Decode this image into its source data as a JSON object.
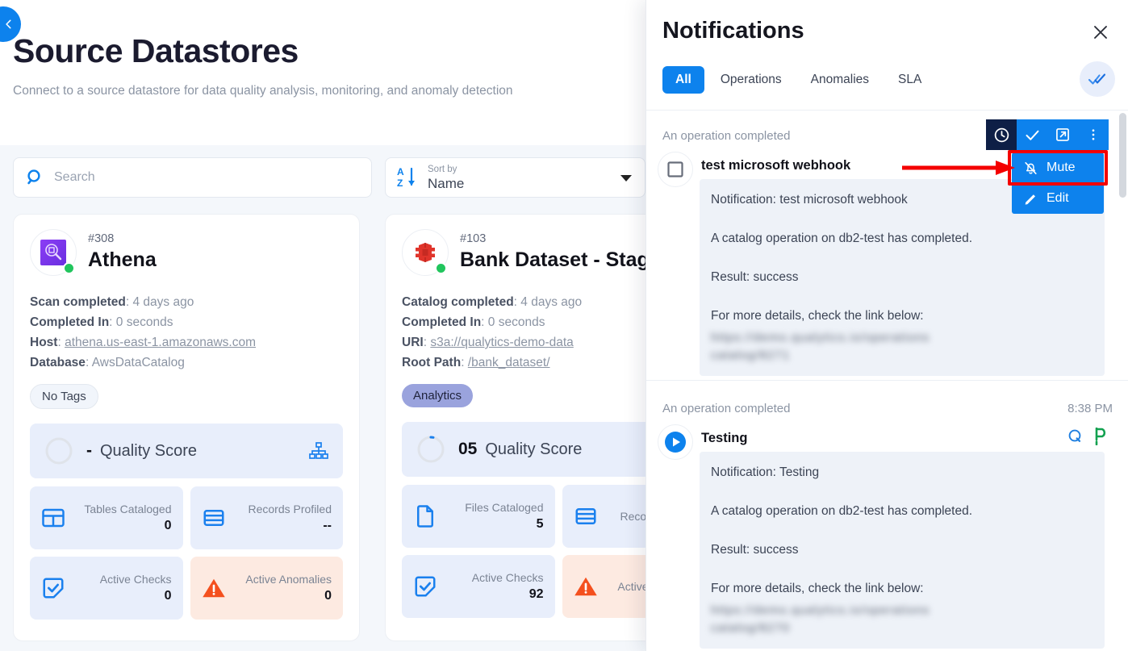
{
  "page": {
    "back_label": "chevron-left",
    "title": "Source Datastores",
    "subtitle": "Connect to a source datastore for data quality analysis, monitoring, and anomaly detection"
  },
  "toolbar": {
    "search_placeholder": "Search",
    "sort_label": "Sort by",
    "sort_value": "Name"
  },
  "cards": [
    {
      "id": "#308",
      "name": "Athena",
      "logo": "athena-logo",
      "status": "online",
      "meta": [
        {
          "label": "Scan completed",
          "value": "4 days ago",
          "link": false
        },
        {
          "label": "Completed In",
          "value": "0 seconds",
          "link": false
        },
        {
          "label": "Host",
          "value": "athena.us-east-1.amazonaws.com",
          "link": true
        },
        {
          "label": "Database",
          "value": "AwsDataCatalog",
          "link": false
        }
      ],
      "tag": "No Tags",
      "tag_style": "none",
      "quality_score": "-",
      "quality_label": "Quality Score",
      "stats": [
        {
          "label": "Tables Cataloged",
          "value": "0",
          "icon": "table-icon",
          "tone": "normal"
        },
        {
          "label": "Records Profiled",
          "value": "--",
          "icon": "records-icon",
          "tone": "normal"
        },
        {
          "label": "Active Checks",
          "value": "0",
          "icon": "check-square-icon",
          "tone": "normal"
        },
        {
          "label": "Active Anomalies",
          "value": "0",
          "icon": "warning-triangle-icon",
          "tone": "warn"
        }
      ]
    },
    {
      "id": "#103",
      "name": "Bank Dataset - Staging",
      "logo": "s3-bucket-logo",
      "status": "online",
      "meta": [
        {
          "label": "Catalog completed",
          "value": "4 days ago",
          "link": false
        },
        {
          "label": "Completed In",
          "value": "0 seconds",
          "link": false
        },
        {
          "label": "URI",
          "value": "s3a://qualytics-demo-data",
          "link": true
        },
        {
          "label": "Root Path",
          "value": "/bank_dataset/",
          "link": true
        }
      ],
      "tag": "Analytics",
      "tag_style": "analytics",
      "quality_score": "05",
      "quality_label": "Quality Score",
      "stats": [
        {
          "label": "Files Cataloged",
          "value": "5",
          "icon": "file-icon",
          "tone": "normal"
        },
        {
          "label": "Records Profiled",
          "value": "",
          "icon": "records-icon",
          "tone": "normal"
        },
        {
          "label": "Active Checks",
          "value": "92",
          "icon": "check-square-icon",
          "tone": "normal"
        },
        {
          "label": "Active Anomalies",
          "value": "",
          "icon": "warning-triangle-icon",
          "tone": "warn"
        }
      ]
    }
  ],
  "panel": {
    "title": "Notifications",
    "close_icon": "close-icon",
    "mark_all_icon": "double-check-icon",
    "tabs": [
      {
        "label": "All",
        "active": true
      },
      {
        "label": "Operations",
        "active": false
      },
      {
        "label": "Anomalies",
        "active": false
      },
      {
        "label": "SLA",
        "active": false
      }
    ],
    "notifications": [
      {
        "top_label": "An operation completed",
        "time": "",
        "avatar_icon": "stop-square-icon",
        "title": "test microsoft webhook",
        "lines": [
          "Notification: test microsoft webhook",
          "A catalog operation on db2-test has completed.",
          "Result: success",
          "For more details, check the link below:"
        ],
        "blurred_link_1": "https://demo.qualytics.io/operations",
        "blurred_link_2": "catalog/8271"
      },
      {
        "top_label": "An operation completed",
        "time": "8:38 PM",
        "avatar_icon": "play-circle-icon",
        "title": "Testing",
        "badges": [
          "qualytics-q-icon",
          "green-p-icon"
        ],
        "lines": [
          "Notification: Testing",
          "A catalog operation on db2-test has completed.",
          "Result: success",
          "For more details, check the link below:"
        ],
        "blurred_link_1": "https://demo.qualytics.io/operations",
        "blurred_link_2": "catalog/8270"
      }
    ],
    "action_toolbar": [
      {
        "icon": "clock-icon",
        "tone": "dark"
      },
      {
        "icon": "check-icon",
        "tone": "blue"
      },
      {
        "icon": "external-link-icon",
        "tone": "blue"
      },
      {
        "icon": "kebab-menu-icon",
        "tone": "blue"
      }
    ],
    "context_menu": [
      {
        "label": "Mute",
        "icon": "bell-off-icon",
        "highlighted": true
      },
      {
        "label": "Edit",
        "icon": "pencil-icon",
        "highlighted": false
      }
    ]
  },
  "colors": {
    "accent_blue": "#0d82ed",
    "dark_navy": "#0e1f46",
    "highlight_red": "#f40000",
    "status_green": "#21c55d",
    "warn_orange": "#f4501e"
  }
}
